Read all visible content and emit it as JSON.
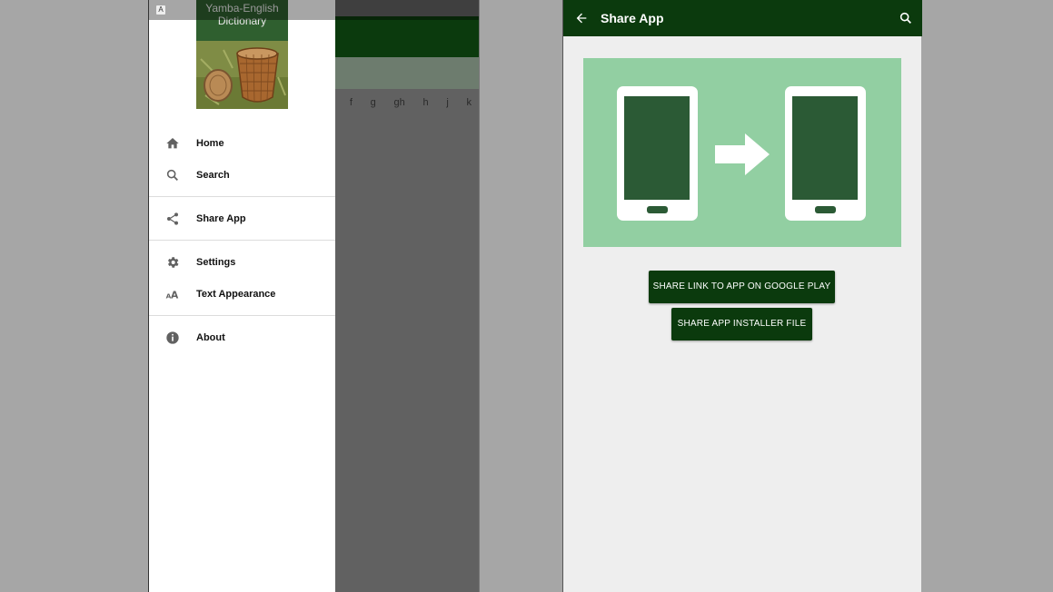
{
  "left_screen": {
    "background_letters": [
      "f",
      "g",
      "gh",
      "h",
      "j",
      "k"
    ],
    "status_icon": "A",
    "drawer": {
      "header_title": "Yamba-English Dictionary",
      "menu": [
        {
          "label": "Home",
          "icon": "home-icon"
        },
        {
          "label": "Search",
          "icon": "search-icon"
        },
        {
          "label": "Share App",
          "icon": "share-icon"
        },
        {
          "label": "Settings",
          "icon": "gear-icon"
        },
        {
          "label": "Text Appearance",
          "icon": "text-size-icon"
        },
        {
          "label": "About",
          "icon": "info-icon"
        }
      ]
    }
  },
  "right_screen": {
    "appbar": {
      "title": "Share App"
    },
    "buttons": {
      "share_link": "SHARE LINK TO APP ON GOOGLE PLAY",
      "share_file": "SHARE APP INSTALLER FILE"
    }
  },
  "colors": {
    "primary_dark": "#0b3a0d",
    "illustration_bg": "#92cfa2",
    "phone_screen": "#2b5a35"
  }
}
